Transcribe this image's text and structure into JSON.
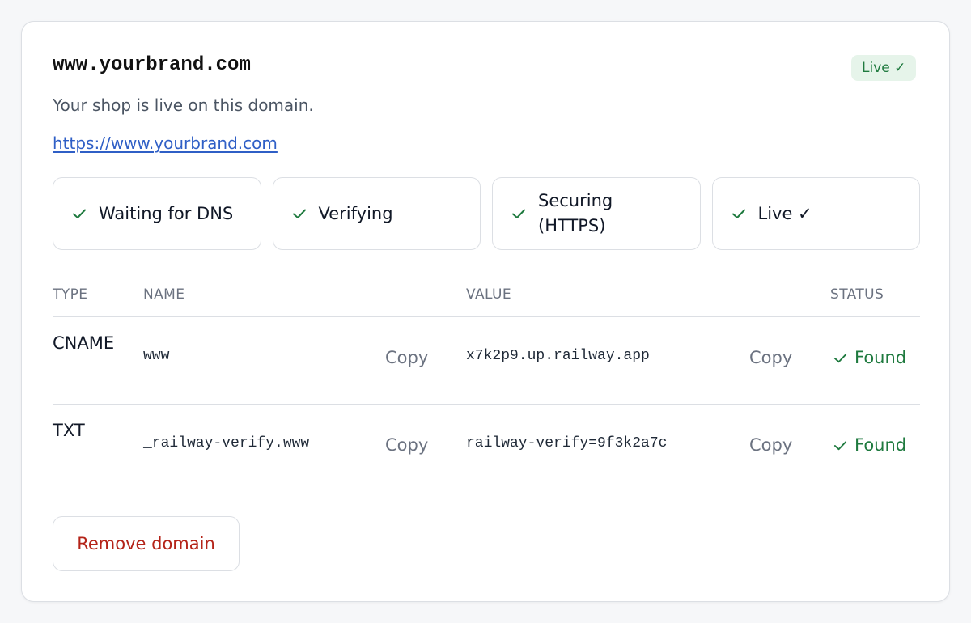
{
  "domain": {
    "name": "www.yourbrand.com",
    "badge": "Live ✓",
    "description": "Your shop is live on this domain.",
    "url": "https://www.yourbrand.com"
  },
  "steps": [
    {
      "label": "Waiting for DNS",
      "status": "complete",
      "icon": "check-icon"
    },
    {
      "label": "Verifying",
      "status": "complete",
      "icon": "check-icon"
    },
    {
      "label": "Securing (HTTPS)",
      "status": "complete",
      "icon": "check-icon"
    },
    {
      "label": "Live ✓",
      "status": "complete",
      "icon": "check-icon"
    }
  ],
  "records": {
    "headers": {
      "type": "TYPE",
      "name": "NAME",
      "value": "VALUE",
      "status": "STATUS"
    },
    "rows": [
      {
        "type": "CNAME",
        "name": "www",
        "name_copy": "Copy",
        "value": "x7k2p9.up.railway.app",
        "value_copy": "Copy",
        "status": "Found"
      },
      {
        "type": "TXT",
        "name": "_railway-verify.www",
        "name_copy": "Copy",
        "value": "railway-verify=9f3k2a7c",
        "value_copy": "Copy",
        "status": "Found"
      }
    ]
  },
  "actions": {
    "remove": "Remove domain"
  },
  "colors": {
    "success": "#1f7a3f",
    "success_bg": "#e6f4ea",
    "link": "#2f5fc6",
    "danger": "#b42318",
    "border": "#dcdfe4"
  }
}
